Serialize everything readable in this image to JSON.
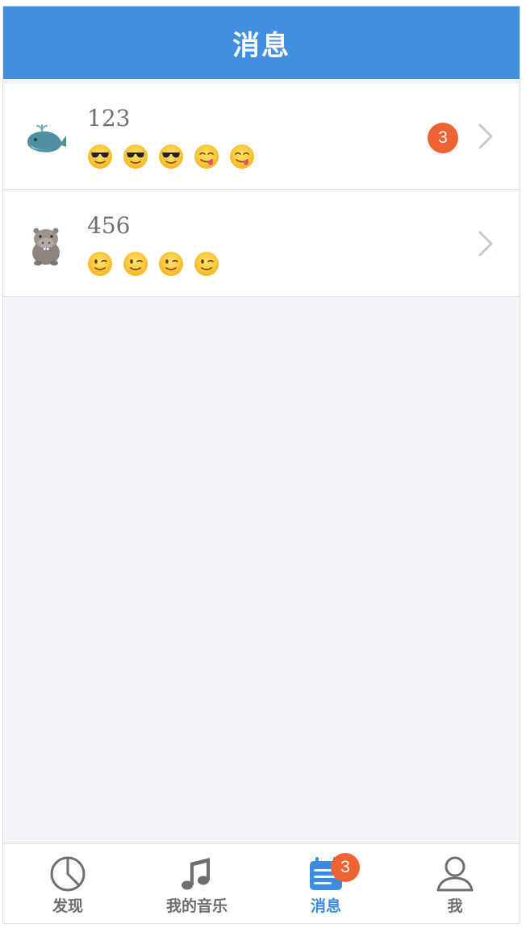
{
  "header": {
    "title": "消息"
  },
  "conversations": [
    {
      "name": "123",
      "avatar": "whale-icon",
      "emojis": [
        "sunglasses-emoji",
        "sunglasses-emoji",
        "sunglasses-emoji",
        "yum-emoji",
        "yum-emoji"
      ],
      "unread": "3"
    },
    {
      "name": "456",
      "avatar": "hippo-icon",
      "emojis": [
        "wink-emoji",
        "wink-emoji",
        "wink-emoji",
        "wink-emoji"
      ],
      "unread": ""
    }
  ],
  "tabbar": {
    "tabs": [
      {
        "label": "发现",
        "icon": "pie-chart-icon",
        "active": false
      },
      {
        "label": "我的音乐",
        "icon": "music-note-icon",
        "active": false
      },
      {
        "label": "消息",
        "icon": "message-list-icon",
        "active": true,
        "badge": "3"
      },
      {
        "label": "我",
        "icon": "user-icon",
        "active": false
      }
    ]
  },
  "colors": {
    "header_bg": "#428fe0",
    "accent": "#3d8ae0",
    "badge": "#ee6332",
    "page_bg": "#f4f4f8"
  }
}
